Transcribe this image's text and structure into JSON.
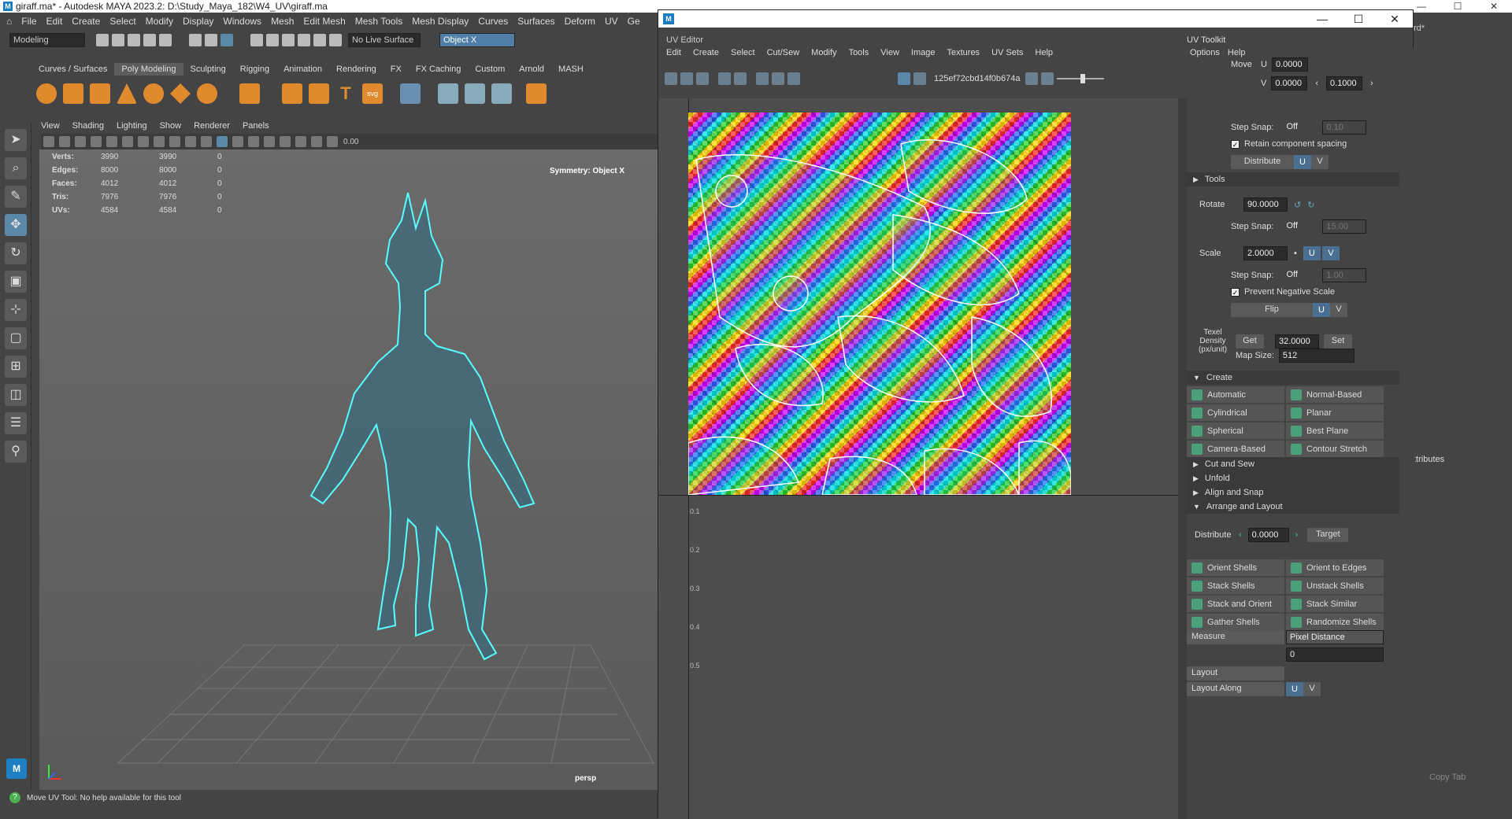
{
  "maya": {
    "title": "giraff.ma* - Autodesk MAYA 2023.2: D:\\Study_Maya_182\\W4_UV\\giraff.ma",
    "menu": [
      "File",
      "Edit",
      "Create",
      "Select",
      "Modify",
      "Display",
      "Windows",
      "Mesh",
      "Edit Mesh",
      "Mesh Tools",
      "Mesh Display",
      "Curves",
      "Surfaces",
      "Deform",
      "UV",
      "Ge"
    ],
    "mode": "Modeling",
    "live_surface": "No Live Surface",
    "symmetry_field": "Object X",
    "shelf_tabs": [
      "Curves / Surfaces",
      "Poly Modeling",
      "Sculpting",
      "Rigging",
      "Animation",
      "Rendering",
      "FX",
      "FX Caching",
      "Custom",
      "Arnold",
      "MASH"
    ],
    "vp_menu": [
      "View",
      "Shading",
      "Lighting",
      "Show",
      "Renderer",
      "Panels"
    ],
    "vp_value": "0.00",
    "hud": [
      {
        "k": "Verts:",
        "a": "3990",
        "b": "3990",
        "c": "0"
      },
      {
        "k": "Edges:",
        "a": "8000",
        "b": "8000",
        "c": "0"
      },
      {
        "k": "Faces:",
        "a": "4012",
        "b": "4012",
        "c": "0"
      },
      {
        "k": "Tris:",
        "a": "7976",
        "b": "7976",
        "c": "0"
      },
      {
        "k": "UVs:",
        "a": "4584",
        "b": "4584",
        "c": "0"
      }
    ],
    "symmetry_hud": "Symmetry: Object X",
    "camera": "persp",
    "helpline": "Move UV Tool: No help available for this tool",
    "logo": "M"
  },
  "right": {
    "workspace": "rd*",
    "attributes": "ttributes",
    "copy_tab": "Copy Tab"
  },
  "uv": {
    "window_label": "UV Editor",
    "toolkit_label": "UV Toolkit",
    "menu": [
      "Edit",
      "Create",
      "Select",
      "Cut/Sew",
      "Modify",
      "Tools",
      "View",
      "Image",
      "Textures",
      "UV Sets",
      "Help"
    ],
    "texture": "125ef72cbd14f0b674a",
    "grid_labels": [
      "0.1",
      "0.2",
      "0.3",
      "0.4",
      "0.5"
    ],
    "toolkit": {
      "menu": [
        "Options",
        "Help"
      ],
      "move_label": "Move",
      "move_u": "0.0000",
      "move_v": "0.0000",
      "move_step": "0.1000",
      "step_snap": "Step Snap:",
      "off": "Off",
      "snap_val1": "0.10",
      "snap_val2": "15.00",
      "snap_val3": "1.00",
      "retain": "Retain component spacing",
      "distribute": "Distribute",
      "u": "U",
      "v": "V",
      "tools": "Tools",
      "rotate_label": "Rotate",
      "rotate_val": "90.0000",
      "scale_label": "Scale",
      "scale_val": "2.0000",
      "prevent": "Prevent Negative Scale",
      "flip": "Flip",
      "texel_label": "Texel Density (px/unit)",
      "get": "Get",
      "texel_val": "32.0000",
      "set": "Set",
      "map_size_label": "Map Size:",
      "map_size": "512",
      "create": "Create",
      "create_items": [
        "Automatic",
        "Normal-Based",
        "Cylindrical",
        "Planar",
        "Spherical",
        "Best Plane",
        "Camera-Based",
        "Contour Stretch"
      ],
      "cut_sew": "Cut and Sew",
      "unfold": "Unfold",
      "align_snap": "Align and Snap",
      "arrange": "Arrange and Layout",
      "distribute_label": "Distribute",
      "distribute_val": "0.0000",
      "target": "Target",
      "arrange_items": [
        "Orient Shells",
        "Orient to Edges",
        "Stack Shells",
        "Unstack Shells",
        "Stack and Orient",
        "Stack Similar",
        "Gather Shells",
        "Randomize Shells"
      ],
      "measure": "Measure",
      "measure_mode": "Pixel Distance",
      "measure_val": "0",
      "layout": "Layout",
      "layout_along": "Layout Along"
    }
  }
}
